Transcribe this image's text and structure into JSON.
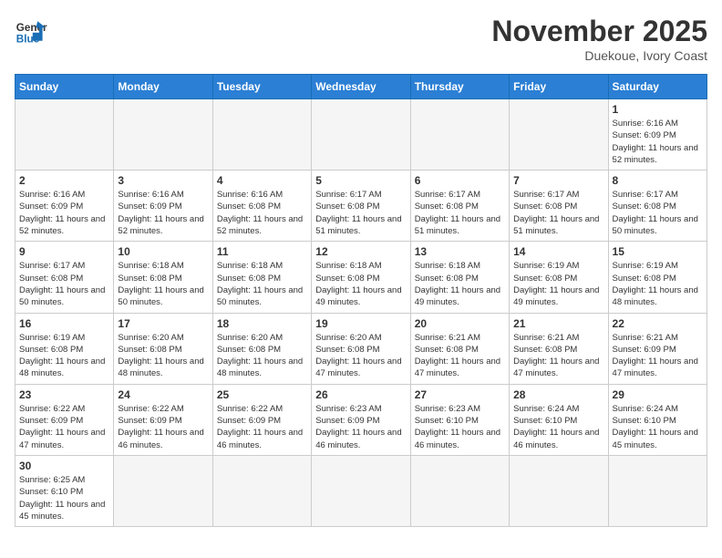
{
  "header": {
    "logo_general": "General",
    "logo_blue": "Blue",
    "month_title": "November 2025",
    "location": "Duekoue, Ivory Coast"
  },
  "days_of_week": [
    "Sunday",
    "Monday",
    "Tuesday",
    "Wednesday",
    "Thursday",
    "Friday",
    "Saturday"
  ],
  "weeks": [
    [
      {
        "day": "",
        "sunrise": "",
        "sunset": "",
        "daylight": ""
      },
      {
        "day": "",
        "sunrise": "",
        "sunset": "",
        "daylight": ""
      },
      {
        "day": "",
        "sunrise": "",
        "sunset": "",
        "daylight": ""
      },
      {
        "day": "",
        "sunrise": "",
        "sunset": "",
        "daylight": ""
      },
      {
        "day": "",
        "sunrise": "",
        "sunset": "",
        "daylight": ""
      },
      {
        "day": "",
        "sunrise": "",
        "sunset": "",
        "daylight": ""
      },
      {
        "day": "1",
        "sunrise": "Sunrise: 6:16 AM",
        "sunset": "Sunset: 6:09 PM",
        "daylight": "Daylight: 11 hours and 52 minutes."
      }
    ],
    [
      {
        "day": "2",
        "sunrise": "Sunrise: 6:16 AM",
        "sunset": "Sunset: 6:09 PM",
        "daylight": "Daylight: 11 hours and 52 minutes."
      },
      {
        "day": "3",
        "sunrise": "Sunrise: 6:16 AM",
        "sunset": "Sunset: 6:09 PM",
        "daylight": "Daylight: 11 hours and 52 minutes."
      },
      {
        "day": "4",
        "sunrise": "Sunrise: 6:16 AM",
        "sunset": "Sunset: 6:08 PM",
        "daylight": "Daylight: 11 hours and 52 minutes."
      },
      {
        "day": "5",
        "sunrise": "Sunrise: 6:17 AM",
        "sunset": "Sunset: 6:08 PM",
        "daylight": "Daylight: 11 hours and 51 minutes."
      },
      {
        "day": "6",
        "sunrise": "Sunrise: 6:17 AM",
        "sunset": "Sunset: 6:08 PM",
        "daylight": "Daylight: 11 hours and 51 minutes."
      },
      {
        "day": "7",
        "sunrise": "Sunrise: 6:17 AM",
        "sunset": "Sunset: 6:08 PM",
        "daylight": "Daylight: 11 hours and 51 minutes."
      },
      {
        "day": "8",
        "sunrise": "Sunrise: 6:17 AM",
        "sunset": "Sunset: 6:08 PM",
        "daylight": "Daylight: 11 hours and 50 minutes."
      }
    ],
    [
      {
        "day": "9",
        "sunrise": "Sunrise: 6:17 AM",
        "sunset": "Sunset: 6:08 PM",
        "daylight": "Daylight: 11 hours and 50 minutes."
      },
      {
        "day": "10",
        "sunrise": "Sunrise: 6:18 AM",
        "sunset": "Sunset: 6:08 PM",
        "daylight": "Daylight: 11 hours and 50 minutes."
      },
      {
        "day": "11",
        "sunrise": "Sunrise: 6:18 AM",
        "sunset": "Sunset: 6:08 PM",
        "daylight": "Daylight: 11 hours and 50 minutes."
      },
      {
        "day": "12",
        "sunrise": "Sunrise: 6:18 AM",
        "sunset": "Sunset: 6:08 PM",
        "daylight": "Daylight: 11 hours and 49 minutes."
      },
      {
        "day": "13",
        "sunrise": "Sunrise: 6:18 AM",
        "sunset": "Sunset: 6:08 PM",
        "daylight": "Daylight: 11 hours and 49 minutes."
      },
      {
        "day": "14",
        "sunrise": "Sunrise: 6:19 AM",
        "sunset": "Sunset: 6:08 PM",
        "daylight": "Daylight: 11 hours and 49 minutes."
      },
      {
        "day": "15",
        "sunrise": "Sunrise: 6:19 AM",
        "sunset": "Sunset: 6:08 PM",
        "daylight": "Daylight: 11 hours and 48 minutes."
      }
    ],
    [
      {
        "day": "16",
        "sunrise": "Sunrise: 6:19 AM",
        "sunset": "Sunset: 6:08 PM",
        "daylight": "Daylight: 11 hours and 48 minutes."
      },
      {
        "day": "17",
        "sunrise": "Sunrise: 6:20 AM",
        "sunset": "Sunset: 6:08 PM",
        "daylight": "Daylight: 11 hours and 48 minutes."
      },
      {
        "day": "18",
        "sunrise": "Sunrise: 6:20 AM",
        "sunset": "Sunset: 6:08 PM",
        "daylight": "Daylight: 11 hours and 48 minutes."
      },
      {
        "day": "19",
        "sunrise": "Sunrise: 6:20 AM",
        "sunset": "Sunset: 6:08 PM",
        "daylight": "Daylight: 11 hours and 47 minutes."
      },
      {
        "day": "20",
        "sunrise": "Sunrise: 6:21 AM",
        "sunset": "Sunset: 6:08 PM",
        "daylight": "Daylight: 11 hours and 47 minutes."
      },
      {
        "day": "21",
        "sunrise": "Sunrise: 6:21 AM",
        "sunset": "Sunset: 6:08 PM",
        "daylight": "Daylight: 11 hours and 47 minutes."
      },
      {
        "day": "22",
        "sunrise": "Sunrise: 6:21 AM",
        "sunset": "Sunset: 6:09 PM",
        "daylight": "Daylight: 11 hours and 47 minutes."
      }
    ],
    [
      {
        "day": "23",
        "sunrise": "Sunrise: 6:22 AM",
        "sunset": "Sunset: 6:09 PM",
        "daylight": "Daylight: 11 hours and 47 minutes."
      },
      {
        "day": "24",
        "sunrise": "Sunrise: 6:22 AM",
        "sunset": "Sunset: 6:09 PM",
        "daylight": "Daylight: 11 hours and 46 minutes."
      },
      {
        "day": "25",
        "sunrise": "Sunrise: 6:22 AM",
        "sunset": "Sunset: 6:09 PM",
        "daylight": "Daylight: 11 hours and 46 minutes."
      },
      {
        "day": "26",
        "sunrise": "Sunrise: 6:23 AM",
        "sunset": "Sunset: 6:09 PM",
        "daylight": "Daylight: 11 hours and 46 minutes."
      },
      {
        "day": "27",
        "sunrise": "Sunrise: 6:23 AM",
        "sunset": "Sunset: 6:10 PM",
        "daylight": "Daylight: 11 hours and 46 minutes."
      },
      {
        "day": "28",
        "sunrise": "Sunrise: 6:24 AM",
        "sunset": "Sunset: 6:10 PM",
        "daylight": "Daylight: 11 hours and 46 minutes."
      },
      {
        "day": "29",
        "sunrise": "Sunrise: 6:24 AM",
        "sunset": "Sunset: 6:10 PM",
        "daylight": "Daylight: 11 hours and 45 minutes."
      }
    ],
    [
      {
        "day": "30",
        "sunrise": "Sunrise: 6:25 AM",
        "sunset": "Sunset: 6:10 PM",
        "daylight": "Daylight: 11 hours and 45 minutes."
      },
      {
        "day": "",
        "sunrise": "",
        "sunset": "",
        "daylight": ""
      },
      {
        "day": "",
        "sunrise": "",
        "sunset": "",
        "daylight": ""
      },
      {
        "day": "",
        "sunrise": "",
        "sunset": "",
        "daylight": ""
      },
      {
        "day": "",
        "sunrise": "",
        "sunset": "",
        "daylight": ""
      },
      {
        "day": "",
        "sunrise": "",
        "sunset": "",
        "daylight": ""
      },
      {
        "day": "",
        "sunrise": "",
        "sunset": "",
        "daylight": ""
      }
    ]
  ]
}
